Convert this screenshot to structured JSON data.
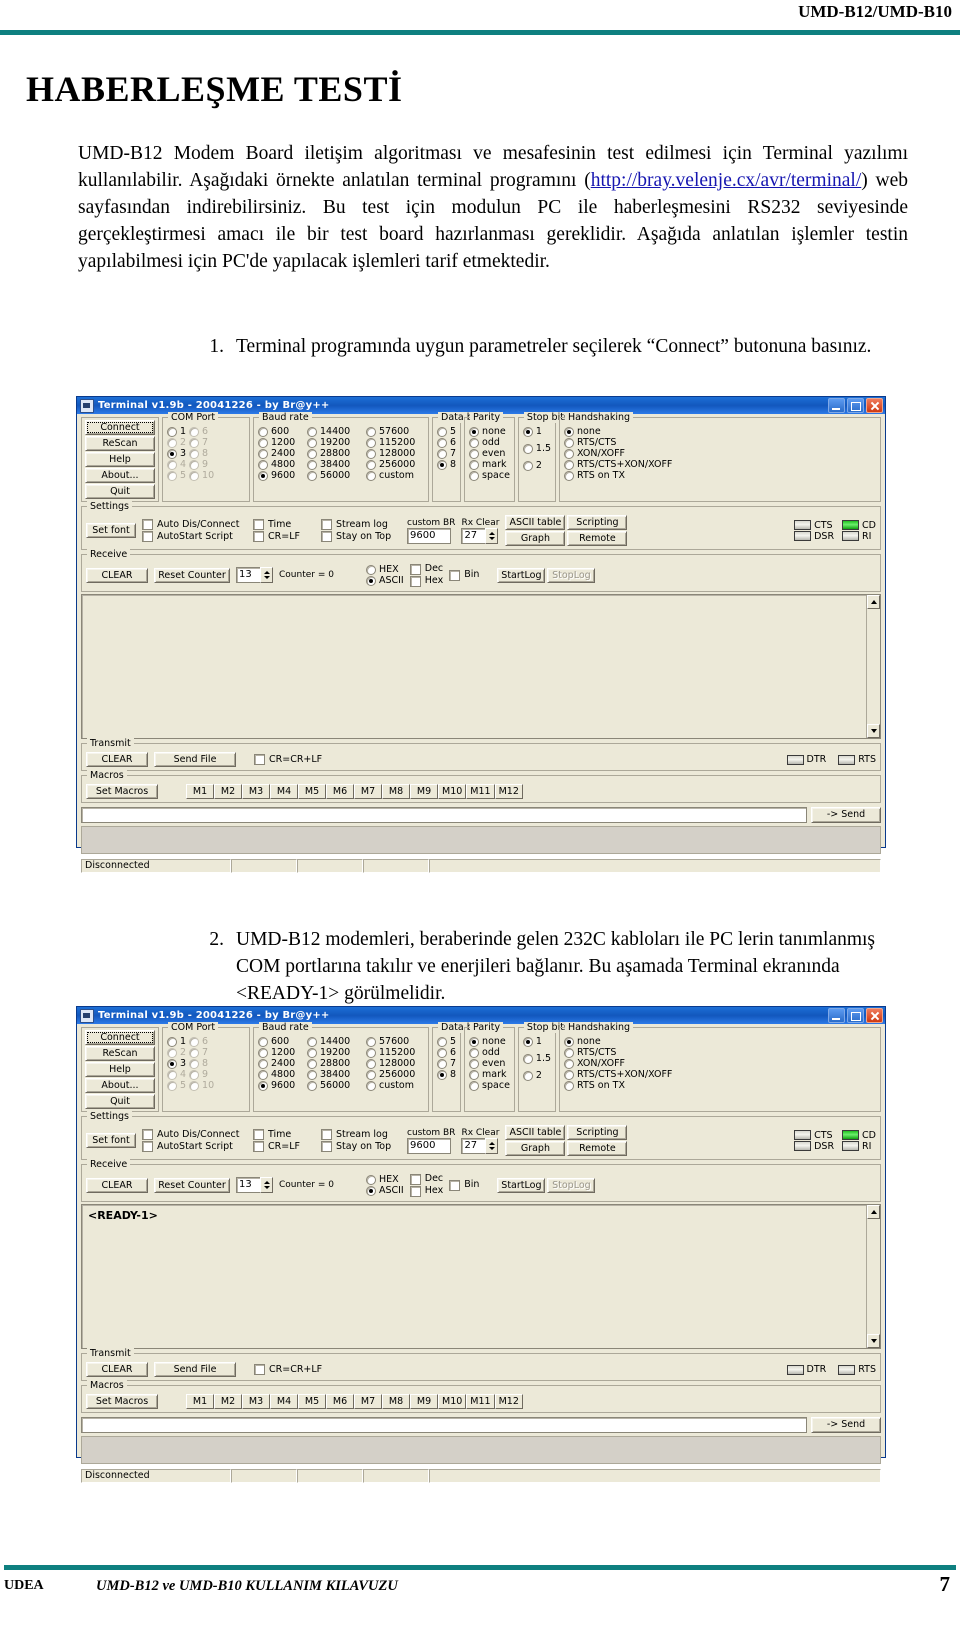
{
  "page": {
    "header_right": "UMD-B12/UMD-B10",
    "title": "HABERLEŞME TESTİ",
    "intro_part1": "UMD-B12 Modem Board iletişim algoritması ve mesafesinin test edilmesi için Terminal  yazılımı kullanılabilir. Aşağıdaki örnekte anlatılan terminal programını (",
    "intro_link": "http://bray.velenje.cx/avr/terminal/",
    "intro_part2": ") web sayfasından indirebilirsiniz. Bu test için modulun PC ile haberleşmesini RS232 seviyesinde gerçekleştirmesi amacı ile bir test board hazırlanması gereklidir. Aşağıda anlatılan işlemler testin yapılabilmesi için PC'de yapılacak işlemleri tarif etmektedir.",
    "step1_num": "1.",
    "step1_text": "Terminal programında uygun parametreler seçilerek “Connect” butonuna basınız.",
    "step2_num": "2.",
    "step2_text": "UMD-B12 modemleri, beraberinde gelen 232C kabloları ile PC lerin tanımlanmış COM portlarına takılır ve enerjileri bağlanır. Bu aşamada Terminal ekranında <READY-1> görülmelidir.",
    "footer_left": "UDEA",
    "footer_mid": "UMD-B12  ve UMD-B10 KULLANIM KILAVUZU",
    "footer_page": "7",
    "accent_color": "#0e8080",
    "link_color": "#1515b0"
  },
  "terminal": {
    "title": "Terminal v1.9b - 20041226 - by Br@y++",
    "titlebar_buttons": {
      "minimize": "minimize-icon",
      "maximize": "maximize-icon",
      "close": "close-icon"
    },
    "main_buttons": [
      "Connect",
      "ReScan",
      "Help",
      "About...",
      "Quit"
    ],
    "com_port": {
      "legend": "COM Port",
      "left": [
        "1",
        "2",
        "3",
        "4",
        "5"
      ],
      "right": [
        "6",
        "7",
        "8",
        "9",
        "10"
      ],
      "selected": "3",
      "disabled": [
        "2",
        "4",
        "5",
        "6",
        "7",
        "8",
        "9",
        "10"
      ]
    },
    "baud_rate": {
      "legend": "Baud rate",
      "col1": [
        "600",
        "1200",
        "2400",
        "4800",
        "9600"
      ],
      "col2": [
        "14400",
        "19200",
        "28800",
        "38400",
        "56000"
      ],
      "col3": [
        "57600",
        "115200",
        "128000",
        "256000",
        "custom"
      ],
      "selected": "9600"
    },
    "data_bits": {
      "legend": "Data bits",
      "options": [
        "5",
        "6",
        "7",
        "8"
      ],
      "selected": "8"
    },
    "parity": {
      "legend": "Parity",
      "options": [
        "none",
        "odd",
        "even",
        "mark",
        "space"
      ],
      "selected": "none"
    },
    "stop_bits": {
      "legend": "Stop bits",
      "options": [
        "1",
        "1.5",
        "2"
      ],
      "selected": "1"
    },
    "handshaking": {
      "legend": "Handshaking",
      "options": [
        "none",
        "RTS/CTS",
        "XON/XOFF",
        "RTS/CTS+XON/XOFF",
        "RTS on TX"
      ],
      "selected": "none"
    },
    "settings": {
      "legend": "Settings",
      "set_font": "Set font",
      "checks": [
        "Auto Dis/Connect",
        "AutoStart Script",
        "Time",
        "CR=LF",
        "Stream log",
        "Stay on Top"
      ],
      "custom_br_label": "custom BR",
      "custom_br_value": "9600",
      "rx_clear_label": "Rx Clear",
      "rx_clear_value": "27",
      "buttons": [
        "ASCII table",
        "Graph",
        "Scripting",
        "Remote"
      ],
      "leds": [
        {
          "name": "CTS",
          "on": false
        },
        {
          "name": "CD",
          "on": true
        },
        {
          "name": "DSR",
          "on": false
        },
        {
          "name": "RI",
          "on": false
        }
      ]
    },
    "receive": {
      "legend": "Receive",
      "clear": "CLEAR",
      "reset_counter": "Reset Counter",
      "reset_value": "13",
      "counter_label": "Counter = 0",
      "radios": [
        "HEX",
        "ASCII"
      ],
      "radio_selected": "ASCII",
      "checks": [
        "Dec",
        "Hex",
        "Bin"
      ],
      "start_log": "StartLog",
      "stop_log": "StopLog",
      "content_window1": "",
      "content_window2": "<READY-1>"
    },
    "transmit": {
      "legend": "Transmit",
      "clear": "CLEAR",
      "send_file": "Send File",
      "check": "CR=CR+LF",
      "leds": [
        {
          "name": "DTR",
          "on": false
        },
        {
          "name": "RTS",
          "on": false
        }
      ]
    },
    "macros": {
      "legend": "Macros",
      "set_macros": "Set Macros",
      "buttons": [
        "M1",
        "M2",
        "M3",
        "M4",
        "M5",
        "M6",
        "M7",
        "M8",
        "M9",
        "M10",
        "M11",
        "M12"
      ]
    },
    "send": {
      "input_value": "",
      "button": "-> Send"
    },
    "status": {
      "text": "Disconnected",
      "cells": [
        "",
        "",
        "",
        ""
      ]
    }
  }
}
